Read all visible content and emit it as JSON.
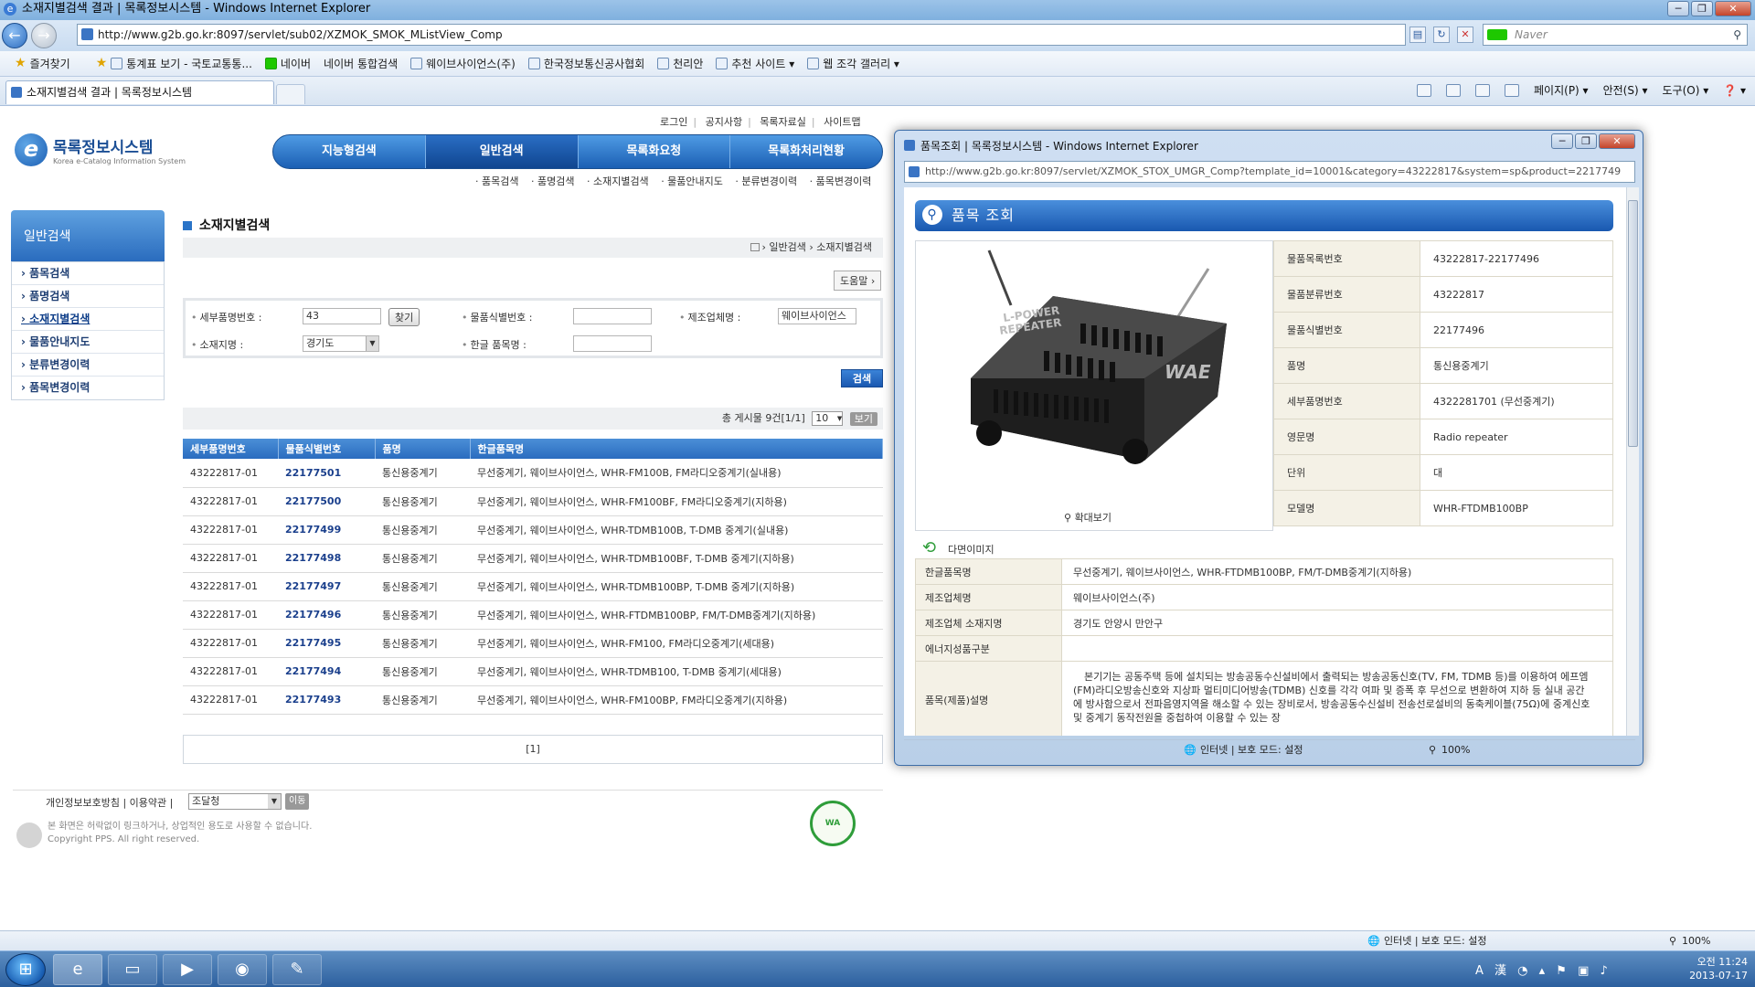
{
  "browser": {
    "title": "소재지별검색 결과 | 목록정보시스템 - Windows Internet Explorer",
    "url": "http://www.g2b.go.kr:8097/servlet/sub02/XZMOK_SMOK_MListView_Comp",
    "search_placeholder": "Naver",
    "favorites_label": "즐겨찾기",
    "favorites": [
      "통계표 보기 - 국토교통통...",
      "네이버",
      "네이버 통합검색",
      "웨이브사이언스(주)",
      "한국정보통신공사협회",
      "천리안",
      "추천 사이트 ▾",
      "웹 조각 갤러리 ▾"
    ],
    "tab_title": "소재지별검색 결과 | 목록정보시스템",
    "commands": [
      "페이지(P) ▾",
      "안전(S) ▾",
      "도구(O) ▾",
      "❓ ▾"
    ],
    "status_text": "인터넷 | 보호 모드: 설정",
    "zoom": "100%"
  },
  "site": {
    "top_links": [
      "로그인",
      "공지사항",
      "목록자료실",
      "사이트맵"
    ],
    "logo_title": "목록정보시스템",
    "logo_sub": "Korea e-Catalog Information System",
    "nav": [
      "지능형검색",
      "일반검색",
      "목록화요청",
      "목록화처리현황"
    ],
    "nav_active": 1,
    "subnav": [
      "· 품목검색",
      "· 품명검색",
      "· 소재지별검색",
      "· 물품안내지도",
      "· 분류변경이력",
      "· 품목변경이력"
    ],
    "left_title": "일반검색",
    "left_menu": [
      "품목검색",
      "품명검색",
      "소재지별검색",
      "물품안내지도",
      "분류변경이력",
      "품목변경이력"
    ],
    "left_active": 2,
    "page_title": "소재지별검색",
    "breadcrumb": "› 일반검색 › 소재지별검색",
    "help": "도움말 ›"
  },
  "form": {
    "detail_no_label": "세부품명번호 :",
    "detail_no_value": "43",
    "find_btn": "찾기",
    "item_id_label": "물품식별번호 :",
    "item_id_value": "",
    "maker_label": "제조업체명 :",
    "maker_value": "웨이브사이언스",
    "region_label": "소재지명 :",
    "region_value": "경기도",
    "kor_name_label": "한글 품목명 :",
    "kor_name_value": "",
    "search_btn": "검색"
  },
  "results": {
    "count_text": "총 게시물 9건[1/1]",
    "page_size": "10",
    "view_btn": "보기",
    "headers": [
      "세부품명번호",
      "물품식별번호",
      "품명",
      "한글품목명"
    ],
    "rows": [
      [
        "43222817-01",
        "22177501",
        "통신용중계기",
        "무선중계기, 웨이브사이언스, WHR-FM100B, FM라디오중계기(실내용)"
      ],
      [
        "43222817-01",
        "22177500",
        "통신용중계기",
        "무선중계기, 웨이브사이언스, WHR-FM100BF, FM라디오중계기(지하용)"
      ],
      [
        "43222817-01",
        "22177499",
        "통신용중계기",
        "무선중계기, 웨이브사이언스, WHR-TDMB100B, T-DMB 중계기(실내용)"
      ],
      [
        "43222817-01",
        "22177498",
        "통신용중계기",
        "무선중계기, 웨이브사이언스, WHR-TDMB100BF, T-DMB 중계기(지하용)"
      ],
      [
        "43222817-01",
        "22177497",
        "통신용중계기",
        "무선중계기, 웨이브사이언스, WHR-TDMB100BP, T-DMB 중계기(지하용)"
      ],
      [
        "43222817-01",
        "22177496",
        "통신용중계기",
        "무선중계기, 웨이브사이언스, WHR-FTDMB100BP, FM/T-DMB중계기(지하용)"
      ],
      [
        "43222817-01",
        "22177495",
        "통신용중계기",
        "무선중계기, 웨이브사이언스, WHR-FM100, FM라디오중계기(세대용)"
      ],
      [
        "43222817-01",
        "22177494",
        "통신용중계기",
        "무선중계기, 웨이브사이언스, WHR-TDMB100, T-DMB 중계기(세대용)"
      ],
      [
        "43222817-01",
        "22177493",
        "통신용중계기",
        "무선중계기, 웨이브사이언스, WHR-FM100BP, FM라디오중계기(지하용)"
      ]
    ],
    "pager": "[1]"
  },
  "footer": {
    "links": "개인정보보호방침 | 이용약관 |",
    "select": "조달청",
    "go": "이동",
    "copy1": "본 화면은 허락없이 링크하거나, 상업적인 용도로 사용할 수 없습니다.",
    "copy2": "Copyright PPS. All right reserved."
  },
  "popup": {
    "title": "품목조회 | 목록정보시스템 - Windows Internet Explorer",
    "url": "http://www.g2b.go.kr:8097/servlet/XZMOK_STOX_UMGR_Comp?template_id=10001&category=43222817&system=sp&product=2217749",
    "heading": "품목 조회",
    "zoom_label": "확대보기",
    "multi_image": "다면이미지",
    "image_text_1": "L-POWER",
    "image_text_2": "REPEATER",
    "image_brand": "WAE",
    "info": [
      [
        "물품목록번호",
        "43222817-22177496"
      ],
      [
        "물품분류번호",
        "43222817"
      ],
      [
        "물품식별번호",
        "22177496"
      ],
      [
        "품명",
        "통신용중계기"
      ],
      [
        "세부품명번호",
        "4322281701 (무선중계기)"
      ],
      [
        "영문명",
        "Radio repeater"
      ],
      [
        "단위",
        "대"
      ],
      [
        "모델명",
        "WHR-FTDMB100BP"
      ]
    ],
    "details": [
      [
        "한글품목명",
        "무선중계기, 웨이브사이언스, WHR-FTDMB100BP, FM/T-DMB중계기(지하용)"
      ],
      [
        "제조업체명",
        "웨이브사이언스(주)"
      ],
      [
        "제조업체 소재지명",
        "경기도 안양시 만안구"
      ],
      [
        "에너지성품구분",
        ""
      ]
    ],
    "desc_label": "품목(제품)설명",
    "desc": "본기기는 공동주택 등에 설치되는 방송공동수신설비에서 출력되는 방송공동신호(TV, FM, TDMB 등)를 이용하여 에프엠(FM)라디오방송신호와 지상파 멀티미디어방송(TDMB) 신호를 각각 여파 및 증폭 후 무선으로 변환하여 지하 등 실내 공간에 방사함으로서 전파음영지역을 해소할 수 있는 장비로서, 방송공동수신설비 전송선로설비의 동축케이블(75Ω)에 중계신호 및 중계기 동작전원을 중첩하여 이용할 수 있는 장",
    "status": "인터넷 | 보호 모드: 설정",
    "zoom": "100%"
  },
  "taskbar": {
    "time": "오전 11:24",
    "date": "2013-07-17",
    "ime": "A 漢"
  }
}
